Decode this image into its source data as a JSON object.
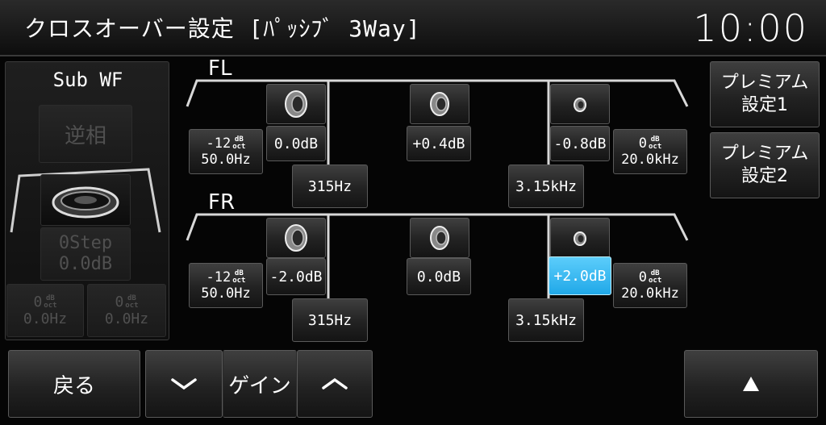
{
  "header": {
    "title": "クロスオーバー設定 [ﾊﾟｯｼﾌﾞ 3Way]",
    "clock": "10:00"
  },
  "subwf": {
    "label": "Sub WF",
    "phase_button": "逆相",
    "step_label": "0Step",
    "gain_value": "0.0dB",
    "hpf_slope": "0",
    "hpf_freq": "0.0Hz",
    "lpf_slope": "0",
    "lpf_freq": "0.0Hz"
  },
  "units": {
    "db_top": "dB",
    "db_bottom": "oct"
  },
  "channels": {
    "fl": {
      "label": "FL",
      "hpf_slope": "-12",
      "hpf_freq": "50.0Hz",
      "woofer_gain": "0.0dB",
      "mid_gain": "+0.4dB",
      "tweeter_gain": "-0.8dB",
      "lpf_slope": "0",
      "lpf_freq": "20.0kHz",
      "crossover_low": "315Hz",
      "crossover_high": "3.15kHz"
    },
    "fr": {
      "label": "FR",
      "hpf_slope": "-12",
      "hpf_freq": "50.0Hz",
      "woofer_gain": "-2.0dB",
      "mid_gain": "0.0dB",
      "tweeter_gain": "+2.0dB",
      "lpf_slope": "0",
      "lpf_freq": "20.0kHz",
      "crossover_low": "315Hz",
      "crossover_high": "3.15kHz"
    }
  },
  "side": {
    "premium1_line1": "プレミアム",
    "premium1_line2": "設定1",
    "premium2_line1": "プレミアム",
    "premium2_line2": "設定2"
  },
  "footer": {
    "back": "戻る",
    "gain": "ゲイン",
    "down_icon": "chevron-down-icon",
    "up_icon": "chevron-up-icon",
    "scroll_up_icon": "triangle-up-icon"
  },
  "colors": {
    "active": "#2ab0ee",
    "background": "#050505",
    "curve": "#d8d8d8"
  }
}
